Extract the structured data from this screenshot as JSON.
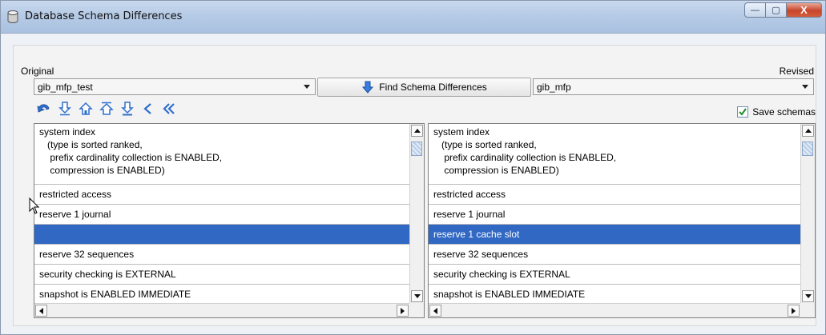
{
  "window": {
    "title": "Database Schema Differences",
    "min_label": "—",
    "max_label": "▢",
    "close_label": "X"
  },
  "labels": {
    "original": "Original",
    "revised": "Revised"
  },
  "original_db": {
    "value": "gib_mfp_test"
  },
  "revised_db": {
    "value": "gib_mfp"
  },
  "find_button": {
    "label": "Find Schema Differences"
  },
  "toolbar": {
    "buttons": [
      "undo-icon",
      "next-diff-icon",
      "home-icon",
      "first-diff-icon",
      "last-diff-icon",
      "previous-icon",
      "rewind-icon"
    ]
  },
  "save_schemas": {
    "label": "Save schemas",
    "checked": true
  },
  "colors": {
    "selection": "#3168c3",
    "accent": "#2f6fce"
  },
  "left_rows": [
    {
      "text": "system index\n   (type is sorted ranked,\n    prefix cardinality collection is ENABLED,\n    compression is ENABLED)",
      "type": "multi"
    },
    {
      "text": "restricted access",
      "type": "single"
    },
    {
      "text": "reserve 1 journal",
      "type": "single"
    },
    {
      "text": "",
      "type": "single",
      "selected": true
    },
    {
      "text": "reserve 32 sequences",
      "type": "single"
    },
    {
      "text": "security checking is EXTERNAL",
      "type": "single"
    },
    {
      "text": "snapshot is ENABLED IMMEDIATE",
      "type": "single"
    }
  ],
  "right_rows": [
    {
      "text": "system index\n   (type is sorted ranked,\n    prefix cardinality collection is ENABLED,\n    compression is ENABLED)",
      "type": "multi"
    },
    {
      "text": "restricted access",
      "type": "single"
    },
    {
      "text": "reserve 1 journal",
      "type": "single"
    },
    {
      "text": "reserve 1 cache slot",
      "type": "single",
      "selected": true
    },
    {
      "text": "reserve 32 sequences",
      "type": "single"
    },
    {
      "text": "security checking is EXTERNAL",
      "type": "single"
    },
    {
      "text": "snapshot is ENABLED IMMEDIATE",
      "type": "single"
    }
  ]
}
